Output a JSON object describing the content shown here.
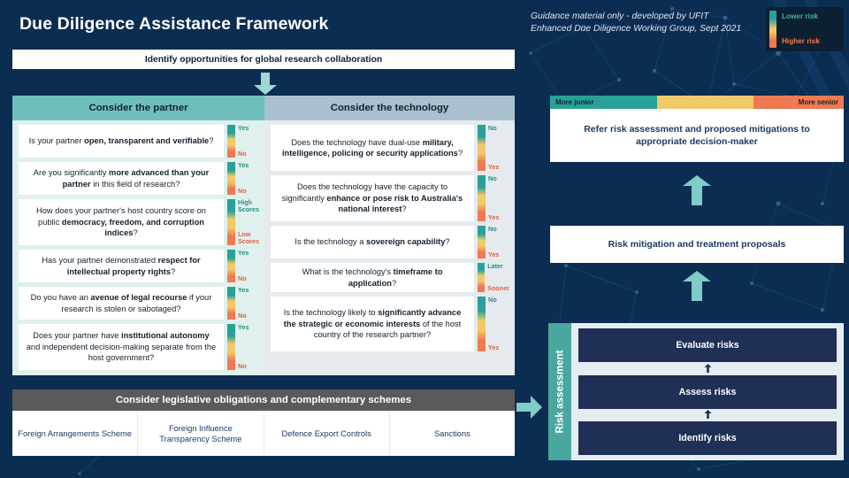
{
  "page": {
    "title": "Due Diligence Assistance Framework",
    "guidance": "Guidance material only - developed by UFIT\nEnhanced Due Diligence Working Group, Sept 2021"
  },
  "legend": {
    "lower_risk": "Lower risk",
    "higher_risk": "Higher risk",
    "color_low": "#2aa198",
    "color_mid": "#f2c969",
    "color_high": "#ef7a52"
  },
  "identify_bar": {
    "label": "Identify opportunities for global research collaboration"
  },
  "panels": [
    {
      "id": "partner",
      "heading": "Consider the partner",
      "header_color": "#6ebfbb",
      "body_color": "#dff0ee",
      "questions": [
        {
          "parts": [
            {
              "text": "Is your partner ",
              "bold": false
            },
            {
              "text": "open, transparent and verifiable",
              "bold": true
            },
            {
              "text": "?",
              "bold": false
            }
          ],
          "low_label": "Yes",
          "high_label": "No"
        },
        {
          "parts": [
            {
              "text": "Are you significantly ",
              "bold": false
            },
            {
              "text": "more advanced than your partner",
              "bold": true
            },
            {
              "text": " in this field of research?",
              "bold": false
            }
          ],
          "low_label": "Yes",
          "high_label": "No"
        },
        {
          "parts": [
            {
              "text": "How does your partner's host country score on public ",
              "bold": false
            },
            {
              "text": "democracy, freedom, and corruption indices",
              "bold": true
            },
            {
              "text": "?",
              "bold": false
            }
          ],
          "low_label": "High Scores",
          "high_label": "Low Scores"
        },
        {
          "parts": [
            {
              "text": "Has your partner demonstrated ",
              "bold": false
            },
            {
              "text": "respect for intellectual property rights",
              "bold": true
            },
            {
              "text": "?",
              "bold": false
            }
          ],
          "low_label": "Yes",
          "high_label": "No"
        },
        {
          "parts": [
            {
              "text": "Do you have an ",
              "bold": false
            },
            {
              "text": "avenue of legal recourse",
              "bold": true
            },
            {
              "text": " if your research is stolen or sabotaged?",
              "bold": false
            }
          ],
          "low_label": "Yes",
          "high_label": "No"
        },
        {
          "parts": [
            {
              "text": "Does your partner have ",
              "bold": false
            },
            {
              "text": "institutional autonomy",
              "bold": true
            },
            {
              "text": " and independent decision-making separate from the host government?",
              "bold": false
            }
          ],
          "low_label": "Yes",
          "high_label": "No"
        }
      ]
    },
    {
      "id": "technology",
      "heading": "Consider the technology",
      "header_color": "#a9c1cf",
      "body_color": "#e5eaee",
      "questions": [
        {
          "parts": [
            {
              "text": "Does the technology have dual-use ",
              "bold": false
            },
            {
              "text": "military, intelligence, policing or security applications",
              "bold": true
            },
            {
              "text": "?",
              "bold": false
            }
          ],
          "low_label": "No",
          "high_label": "Yes"
        },
        {
          "parts": [
            {
              "text": "Does the technology have the capacity to significantly ",
              "bold": false
            },
            {
              "text": "enhance or pose risk to Australia's national interest",
              "bold": true
            },
            {
              "text": "?",
              "bold": false
            }
          ],
          "low_label": "No",
          "high_label": "Yes"
        },
        {
          "parts": [
            {
              "text": "Is the technology a ",
              "bold": false
            },
            {
              "text": "sovereign capability",
              "bold": true
            },
            {
              "text": "?",
              "bold": false
            }
          ],
          "low_label": "No",
          "high_label": "Yes"
        },
        {
          "parts": [
            {
              "text": "What is the technology's ",
              "bold": false
            },
            {
              "text": "timeframe to application",
              "bold": true
            },
            {
              "text": "?",
              "bold": false
            }
          ],
          "low_label": "Later",
          "high_label": "Sooner"
        },
        {
          "parts": [
            {
              "text": "Is the technology likely to ",
              "bold": false
            },
            {
              "text": "significantly advance the strategic or economic interests",
              "bold": true
            },
            {
              "text": " of the host country of the research partner?",
              "bold": false
            }
          ],
          "low_label": "No",
          "high_label": "Yes"
        }
      ]
    }
  ],
  "legislative": {
    "heading": "Consider legislative obligations and complementary schemes",
    "items": [
      "Foreign Arrangements Scheme",
      "Foreign Influence Transparency Scheme",
      "Defence Export Controls",
      "Sanctions"
    ]
  },
  "refer": {
    "junior_label": "More junior",
    "senior_label": "More senior",
    "body": "Refer risk assessment and proposed mitigations to appropriate decision-maker"
  },
  "mitigation": {
    "label": "Risk mitigation and treatment proposals"
  },
  "risk_assessment": {
    "side_label": "Risk assessment",
    "steps": [
      "Evaluate risks",
      "Assess risks",
      "Identify risks"
    ]
  }
}
